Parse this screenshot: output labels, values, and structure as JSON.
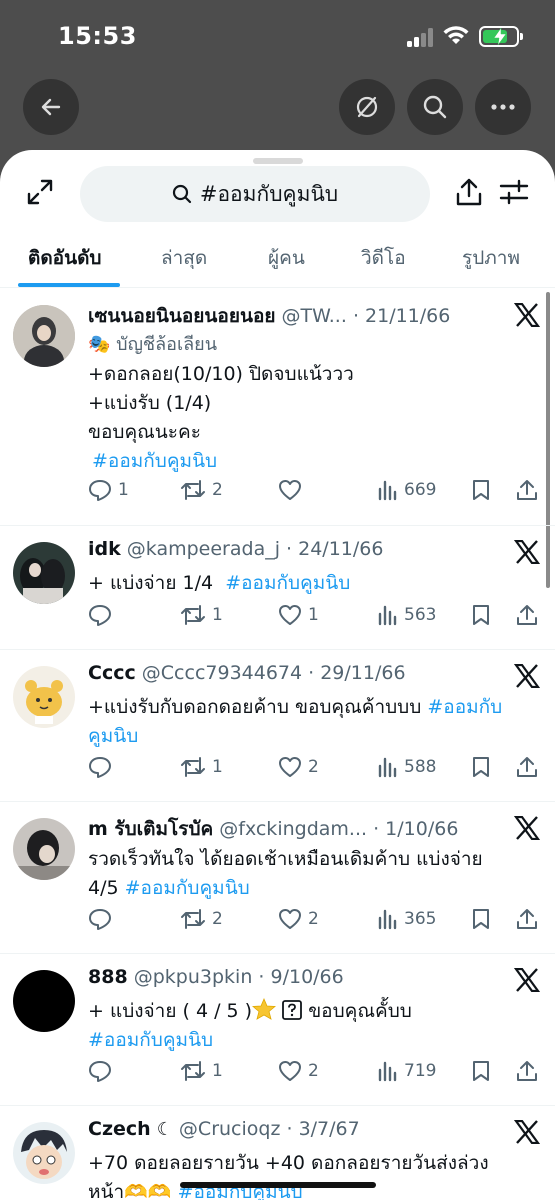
{
  "status": {
    "time": "15:53"
  },
  "colors": {
    "accent": "#1d9bf0",
    "text": "#0f1419",
    "muted": "#536471",
    "battery": "#34c759"
  },
  "nav": {
    "back_icon": "arrow-left-icon",
    "grok_icon": "slash-circle-icon",
    "search_icon": "search-icon",
    "more_icon": "more-horizontal-icon"
  },
  "search": {
    "query": "#ออมกับคูมนิบ"
  },
  "tabs": [
    "ติดอันดับ",
    "ล่าสุด",
    "ผู้คน",
    "วิดีโอ",
    "รูปภาพ"
  ],
  "tweets": [
    {
      "name": "เซนนอยนินอยนอยนอย",
      "handle": "@TW...",
      "date": "· 21/11/66",
      "parody": "บัญชีล้อเลียน",
      "lines": [
        "+ดอกลอย(10/10) ปิดจบแน้ววว",
        "+แบ่งรับ (1/4)",
        "ขอบคุณนะคะ"
      ],
      "hashtag": "#ออมกับคูมนิบ",
      "replies": "1",
      "reposts": "2",
      "likes": "",
      "views": "669"
    },
    {
      "name": "idk",
      "handle": "@kampeerada_j",
      "date": "· 24/11/66",
      "text": "+ แบ่งจ่าย 1/4",
      "hashtag": "#ออมกับคูมนิบ",
      "replies": "",
      "reposts": "1",
      "likes": "1",
      "views": "563"
    },
    {
      "name": "Cccc",
      "handle": "@Cccc79344674",
      "date": "· 29/11/66",
      "text": "+แบ่งรับกับดอกดอยค้าบ ขอบคุณค้าบบบ",
      "hashtag_a": "#ออมกับ",
      "hashtag_b": "คูมนิบ",
      "replies": "",
      "reposts": "1",
      "likes": "2",
      "views": "588"
    },
    {
      "name": "m รับเติมโรบัค",
      "handle": "@fxckingdam...",
      "date": "· 1/10/66",
      "text": "รวดเร็วทันใจ ได้ยอดเช้าเหมือนเดิมค้าบ แบ่งจ่าย",
      "text2": "4/5",
      "hashtag": "#ออมกับคูมนิบ",
      "replies": "",
      "reposts": "2",
      "likes": "2",
      "views": "365"
    },
    {
      "name": "888",
      "handle": "@pkpu3pkin",
      "date": "· 9/10/66",
      "text": "+ แบ่งจ่าย ( 4 / 5 )",
      "text_after": "ขอบคุณคั้บบ",
      "hashtag": "#ออมกับคูมนิบ",
      "replies": "",
      "reposts": "1",
      "likes": "2",
      "views": "719"
    },
    {
      "name": "Czech",
      "handle": "@Crucioqz",
      "date": "· 3/7/67",
      "text": "+70 ดอยลอยรายวัน +40 ดอกลอยรายวันส่งล่วง",
      "text2": "หน้า",
      "hashtag": "#ออมกับคูมนิบ"
    }
  ]
}
